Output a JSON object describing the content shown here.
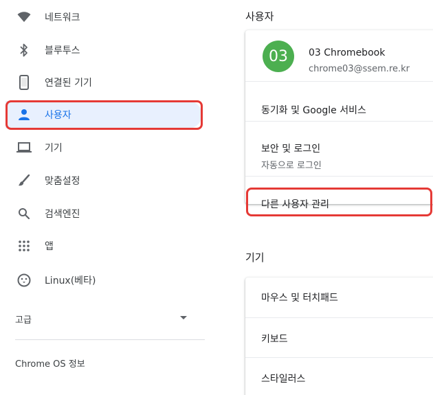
{
  "sidebar": {
    "items": [
      {
        "label": "네트워크",
        "icon": "wifi-icon"
      },
      {
        "label": "블루투스",
        "icon": "bluetooth-icon"
      },
      {
        "label": "연결된 기기",
        "icon": "phone-icon"
      },
      {
        "label": "사용자",
        "icon": "person-icon",
        "selected": true
      },
      {
        "label": "기기",
        "icon": "laptop-icon"
      },
      {
        "label": "맞춤설정",
        "icon": "brush-icon"
      },
      {
        "label": "검색엔진",
        "icon": "search-icon"
      },
      {
        "label": "앱",
        "icon": "apps-grid-icon"
      },
      {
        "label": "Linux(베타)",
        "icon": "penguin-icon"
      }
    ],
    "advanced_label": "고급",
    "about_label": "Chrome OS 정보"
  },
  "users_section": {
    "title": "사용자",
    "account": {
      "avatar_text": "03",
      "name": "03 Chromebook",
      "email": "chrome03@ssem.re.kr"
    },
    "sync_label": "동기화 및 Google 서비스",
    "security": {
      "title": "보안 및 로그인",
      "subtitle": "자동으로 로그인"
    },
    "manage_other_users": "다른 사용자 관리"
  },
  "device_section": {
    "title": "기기",
    "items": [
      "마우스 및 터치패드",
      "키보드",
      "스타일러스"
    ]
  },
  "colors": {
    "accent": "#1a73e8",
    "highlight": "#e53935",
    "avatar_bg": "#4caf50"
  }
}
